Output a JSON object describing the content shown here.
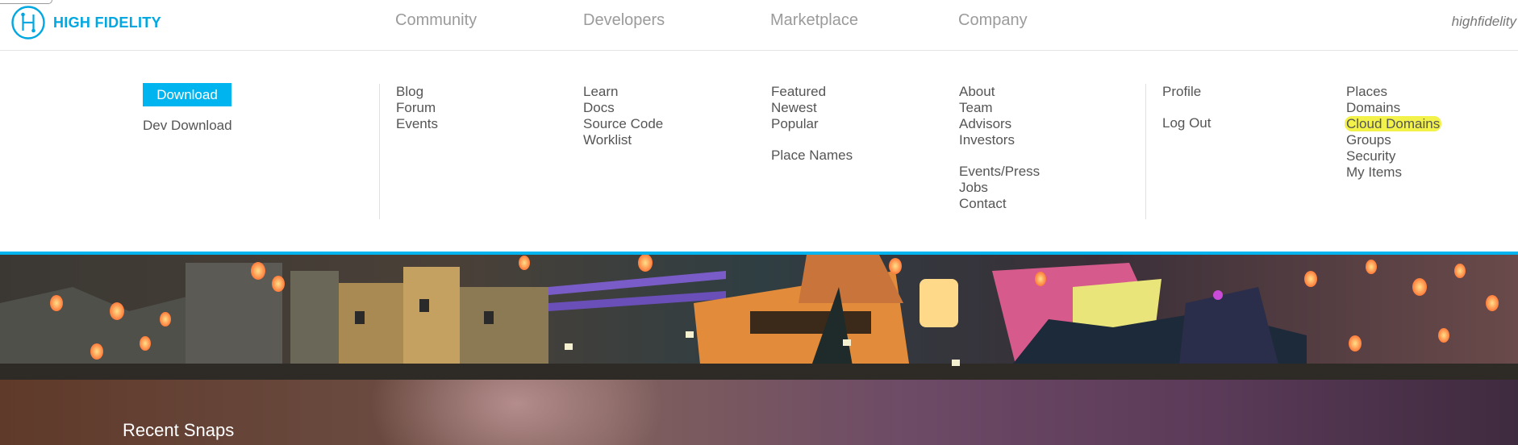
{
  "brand": {
    "name": "HIGH FIDELITY",
    "accent": "#00b4ef"
  },
  "nav": {
    "community": "Community",
    "developers": "Developers",
    "marketplace": "Marketplace",
    "company": "Company",
    "user": "highfidelity"
  },
  "menu": {
    "download": {
      "button": "Download",
      "dev": "Dev Download"
    },
    "community": [
      "Blog",
      "Forum",
      "Events"
    ],
    "developers": [
      "Learn",
      "Docs",
      "Source Code",
      "Worklist"
    ],
    "marketplace": {
      "group1": [
        "Featured",
        "Newest",
        "Popular"
      ],
      "group2": [
        "Place Names"
      ]
    },
    "company": {
      "group1": [
        "About",
        "Team",
        "Advisors",
        "Investors"
      ],
      "group2": [
        "Events/Press",
        "Jobs",
        "Contact"
      ]
    },
    "account": {
      "profile": "Profile",
      "logout": "Log Out"
    },
    "places": [
      "Places",
      "Domains",
      "Cloud Domains",
      "Groups",
      "Security",
      "My Items"
    ],
    "highlighted_item": "Cloud Domains",
    "highlight_color": "#f3f24a"
  },
  "snaps": {
    "title": "Recent Snaps"
  }
}
